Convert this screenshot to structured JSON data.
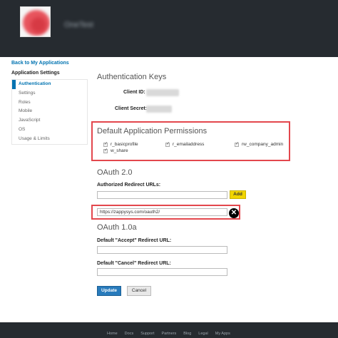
{
  "header": {
    "app_name": "OneTest"
  },
  "nav": {
    "back_link": "Back to My Applications",
    "settings_title": "Application Settings",
    "items": [
      "Authentication",
      "Settings",
      "Roles",
      "Mobile",
      "JavaScript",
      "OS",
      "Usage & Limits"
    ]
  },
  "auth_keys": {
    "heading": "Authentication Keys",
    "client_id_label": "Client ID:",
    "client_secret_label": "Client Secret:"
  },
  "permissions": {
    "heading": "Default Application Permissions",
    "items": [
      "r_basicprofile",
      "r_emailaddress",
      "rw_company_admin",
      "w_share"
    ]
  },
  "oauth2": {
    "heading": "OAuth 2.0",
    "redirect_label": "Authorized Redirect URLs:",
    "redirect_input_value": "",
    "add_label": "Add",
    "existing_url": "https://zappysys.com/oauth2/",
    "remove_icon": "close-circle-icon"
  },
  "oauth1": {
    "heading": "OAuth 1.0a",
    "accept_label": "Default \"Accept\" Redirect URL:",
    "accept_value": "",
    "cancel_label": "Default \"Cancel\" Redirect URL:",
    "cancel_value": ""
  },
  "actions": {
    "update": "Update",
    "cancel": "Cancel"
  },
  "footer": {
    "links": [
      "Home",
      "Docs",
      "Support",
      "Partners",
      "Blog",
      "Legal",
      "My Apps"
    ]
  },
  "colors": {
    "link": "#0073b1",
    "header_bg": "#262b30",
    "highlight": "#e3474d",
    "add_button": "#f1d500",
    "primary_button": "#287bbc"
  }
}
